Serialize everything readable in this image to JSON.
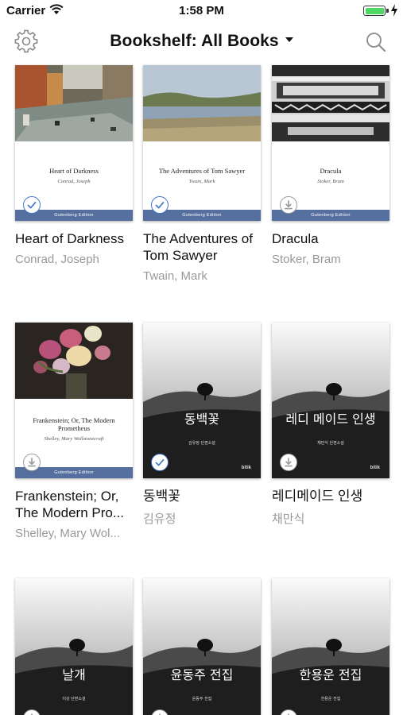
{
  "status": {
    "carrier": "Carrier",
    "time": "1:58 PM"
  },
  "nav": {
    "title": "Bookshelf: All Books"
  },
  "books": [
    {
      "title": "Heart of Darkness",
      "author": "Conrad, Joseph",
      "cover_title": "Heart of Darkness",
      "cover_author": "Conrad, Joseph",
      "cover_edition": "Gutenberg Edition",
      "status_icon": "checkmark-icon"
    },
    {
      "title": "The Adventures of Tom Sawyer",
      "author": "Twain, Mark",
      "cover_title": "The Adventures of Tom Sawyer",
      "cover_author": "Twain, Mark",
      "cover_edition": "Gutenberg Edition",
      "status_icon": "checkmark-icon"
    },
    {
      "title": "Dracula",
      "author": "Stoker, Bram",
      "cover_title": "Dracula",
      "cover_author": "Stoker, Bram",
      "cover_edition": "Gutenberg Edition",
      "status_icon": "download-icon"
    },
    {
      "title": "Frankenstein; Or, The Modern Pro...",
      "author": "Shelley, Mary Wol...",
      "cover_title": "Frankenstein; Or, The Modern Prometheus",
      "cover_author": "Shelley, Mary Wollstonecraft",
      "cover_edition": "Gutenberg Edition",
      "status_icon": "download-icon"
    },
    {
      "title": "동백꽃",
      "author": "김유정",
      "cover_title": "동백꽃",
      "cover_subtitle": "김유정 단편소설",
      "cover_publisher": "bitik",
      "status_icon": "checkmark-icon"
    },
    {
      "title": "레디메이드 인생",
      "author": "채만식",
      "cover_title": "레디 메이드 인생",
      "cover_subtitle": "채만식 단편소설",
      "cover_publisher": "bitik",
      "status_icon": "download-icon"
    },
    {
      "cover_title": "날개",
      "cover_subtitle": "이상 단편소설",
      "status_icon": "download-icon"
    },
    {
      "cover_title": "윤동주 전집",
      "cover_subtitle": "윤동주 전집",
      "status_icon": "download-icon"
    },
    {
      "cover_title": "한용운 전집",
      "cover_subtitle": "한용운 전집",
      "status_icon": "download-icon"
    }
  ]
}
